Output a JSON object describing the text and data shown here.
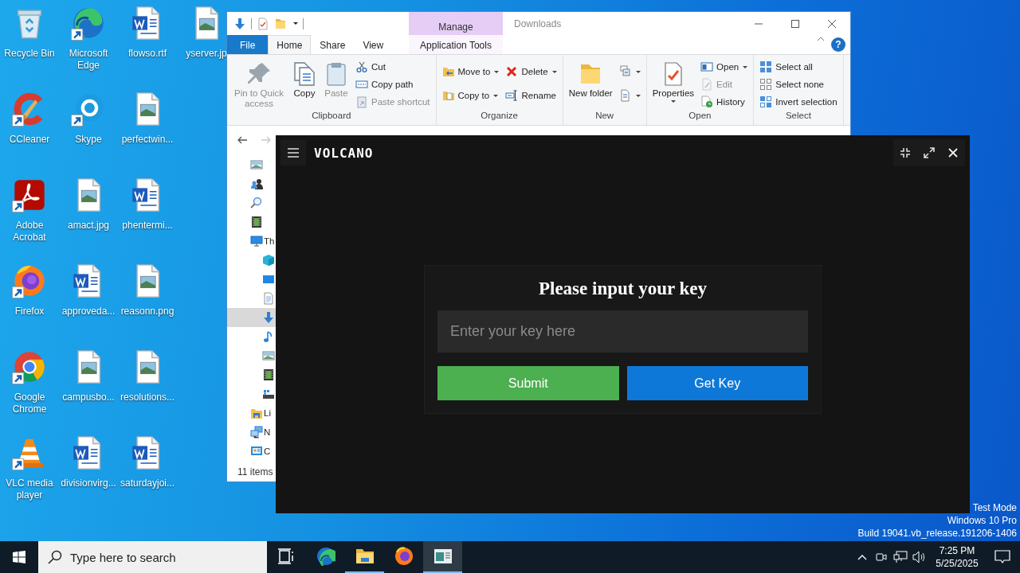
{
  "desktop": {
    "icons": [
      {
        "label": "Recycle Bin",
        "kind": "recycle",
        "shortcut": false
      },
      {
        "label": "CCleaner",
        "kind": "ccleaner",
        "shortcut": true
      },
      {
        "label": "Adobe Acrobat",
        "kind": "acrobat",
        "shortcut": true
      },
      {
        "label": "Firefox",
        "kind": "firefox",
        "shortcut": true
      },
      {
        "label": "Google Chrome",
        "kind": "chrome",
        "shortcut": true
      },
      {
        "label": "VLC media player",
        "kind": "vlc",
        "shortcut": true
      },
      {
        "label": "Microsoft Edge",
        "kind": "edge",
        "shortcut": true
      },
      {
        "label": "Skype",
        "kind": "skype",
        "shortcut": true
      },
      {
        "label": "amact.jpg",
        "kind": "image",
        "shortcut": false
      },
      {
        "label": "approveda...",
        "kind": "word",
        "shortcut": false
      },
      {
        "label": "campusbo...",
        "kind": "image",
        "shortcut": false
      },
      {
        "label": "divisionvirg...",
        "kind": "word",
        "shortcut": false
      },
      {
        "label": "flowso.rtf",
        "kind": "word",
        "shortcut": false
      },
      {
        "label": "perfectwin...",
        "kind": "image",
        "shortcut": false
      },
      {
        "label": "phentermi...",
        "kind": "word",
        "shortcut": false
      },
      {
        "label": "reasonn.png",
        "kind": "image",
        "shortcut": false
      },
      {
        "label": "resolutions...",
        "kind": "image",
        "shortcut": false
      },
      {
        "label": "saturdayjoi...",
        "kind": "word",
        "shortcut": false
      },
      {
        "label": "yserver.jp",
        "kind": "image",
        "shortcut": false
      }
    ]
  },
  "explorer": {
    "title": "Downloads",
    "contextual_tab": "Manage",
    "help": "?",
    "tabs": [
      {
        "label": "File",
        "kind": "file",
        "selected": false
      },
      {
        "label": "Home",
        "kind": "normal",
        "selected": true
      },
      {
        "label": "Share",
        "kind": "normal",
        "selected": false
      },
      {
        "label": "View",
        "kind": "normal",
        "selected": false
      },
      {
        "label": "Application Tools",
        "kind": "contextual",
        "selected": false
      }
    ],
    "groups": [
      {
        "label": "Clipboard",
        "columns": [
          [
            {
              "label": "Pin to Quick access",
              "kind": "large",
              "disabled": true,
              "dropdown": false
            }
          ],
          [
            {
              "label": "Copy",
              "kind": "large",
              "disabled": false,
              "dropdown": false
            }
          ],
          [
            {
              "label": "Paste",
              "kind": "large",
              "disabled": true,
              "dropdown": false
            }
          ],
          [
            {
              "label": "Cut",
              "kind": "small",
              "disabled": false,
              "dropdown": false
            },
            {
              "label": "Copy path",
              "kind": "small",
              "disabled": false,
              "dropdown": false
            },
            {
              "label": "Paste shortcut",
              "kind": "small",
              "disabled": true,
              "dropdown": false
            }
          ]
        ]
      },
      {
        "label": "Organize",
        "columns": [
          [
            {
              "label": "Move to",
              "kind": "small",
              "disabled": false,
              "dropdown": true
            },
            {
              "label": "Copy to",
              "kind": "small",
              "disabled": false,
              "dropdown": true
            }
          ],
          [
            {
              "label": "Delete",
              "kind": "small",
              "disabled": false,
              "dropdown": true
            },
            {
              "label": "Rename",
              "kind": "small",
              "disabled": false,
              "dropdown": false
            }
          ]
        ]
      },
      {
        "label": "New",
        "columns": [
          [
            {
              "label": "New folder",
              "kind": "large",
              "disabled": false,
              "dropdown": false
            }
          ],
          [
            {
              "kind": "icon",
              "disabled": false,
              "dropdown": true
            },
            {
              "kind": "icon",
              "disabled": false,
              "dropdown": true
            }
          ]
        ]
      },
      {
        "label": "Open",
        "columns": [
          [
            {
              "label": "Properties",
              "kind": "large",
              "disabled": false,
              "dropdown": true
            }
          ],
          [
            {
              "label": "Open",
              "kind": "small",
              "disabled": false,
              "dropdown": true
            },
            {
              "label": "Edit",
              "kind": "small",
              "disabled": true,
              "dropdown": false
            },
            {
              "label": "History",
              "kind": "small",
              "disabled": false,
              "dropdown": false
            }
          ]
        ]
      },
      {
        "label": "Select",
        "columns": [
          [
            {
              "label": "Select all",
              "kind": "small",
              "disabled": false,
              "dropdown": false
            },
            {
              "label": "Select none",
              "kind": "small",
              "disabled": false,
              "dropdown": false
            },
            {
              "label": "Invert selection",
              "kind": "small",
              "disabled": false,
              "dropdown": false
            }
          ]
        ]
      }
    ],
    "nav_pane": [
      {
        "kind": "image",
        "selected": false
      },
      {
        "kind": "people",
        "selected": false
      },
      {
        "kind": "search",
        "selected": false
      },
      {
        "kind": "video",
        "selected": false
      },
      {
        "kind": "pc",
        "label": "Th",
        "selected": false,
        "children": [
          {
            "kind": "cube",
            "selected": false
          },
          {
            "kind": "desktop",
            "selected": false
          },
          {
            "kind": "doc",
            "selected": false
          },
          {
            "kind": "download",
            "selected": true
          },
          {
            "kind": "music",
            "selected": false
          },
          {
            "kind": "image",
            "selected": false
          },
          {
            "kind": "video",
            "selected": false
          },
          {
            "kind": "drive",
            "selected": false
          }
        ]
      },
      {
        "kind": "library",
        "label": "Li",
        "selected": false
      },
      {
        "kind": "network",
        "label": "N",
        "selected": false
      },
      {
        "kind": "control",
        "label": "C",
        "selected": false
      }
    ],
    "status": "11 items"
  },
  "volcano": {
    "title": "VOLCANO",
    "prompt": "Please input your key",
    "input": {
      "placeholder": "Enter your key here"
    },
    "buttons": [
      {
        "label": "Submit",
        "kind": "submit"
      },
      {
        "label": "Get Key",
        "kind": "link"
      }
    ]
  },
  "system_text": [
    "Test Mode",
    "Windows 10 Pro",
    "Build 19041.vb_release.191206-1406"
  ],
  "taskbar": {
    "search": {
      "placeholder": "Type here to search"
    },
    "apps": [
      {
        "kind": "taskview",
        "running": false,
        "active": false
      },
      {
        "kind": "edge",
        "running": false,
        "active": false
      },
      {
        "kind": "explorer",
        "running": true,
        "active": false
      },
      {
        "kind": "firefox",
        "running": false,
        "active": false
      },
      {
        "kind": "volcano",
        "running": true,
        "active": true
      }
    ],
    "clock": {
      "time": "7:25 PM",
      "date": "5/25/2025"
    }
  }
}
